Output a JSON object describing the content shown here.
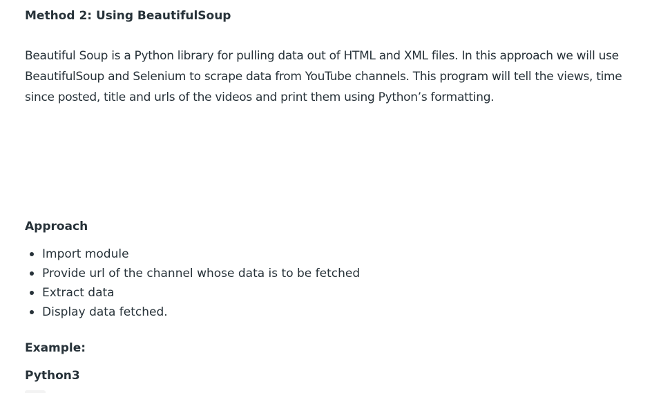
{
  "article": {
    "method_heading": "Method 2: Using BeautifulSoup",
    "intro_paragraph": "Beautiful Soup is a Python library for pulling data out of HTML and XML files. In this approach we will use BeautifulSoup and Selenium to scrape data from YouTube channels. This program will tell the views, time since posted, title and urls of the videos and print them using Python’s formatting.",
    "approach_heading": "Approach",
    "approach_steps": [
      "Import module",
      "Provide url of the channel whose data is to be fetched",
      "Extract data",
      "Display data fetched."
    ],
    "example_heading": "Example:",
    "language_label": "Python3"
  }
}
